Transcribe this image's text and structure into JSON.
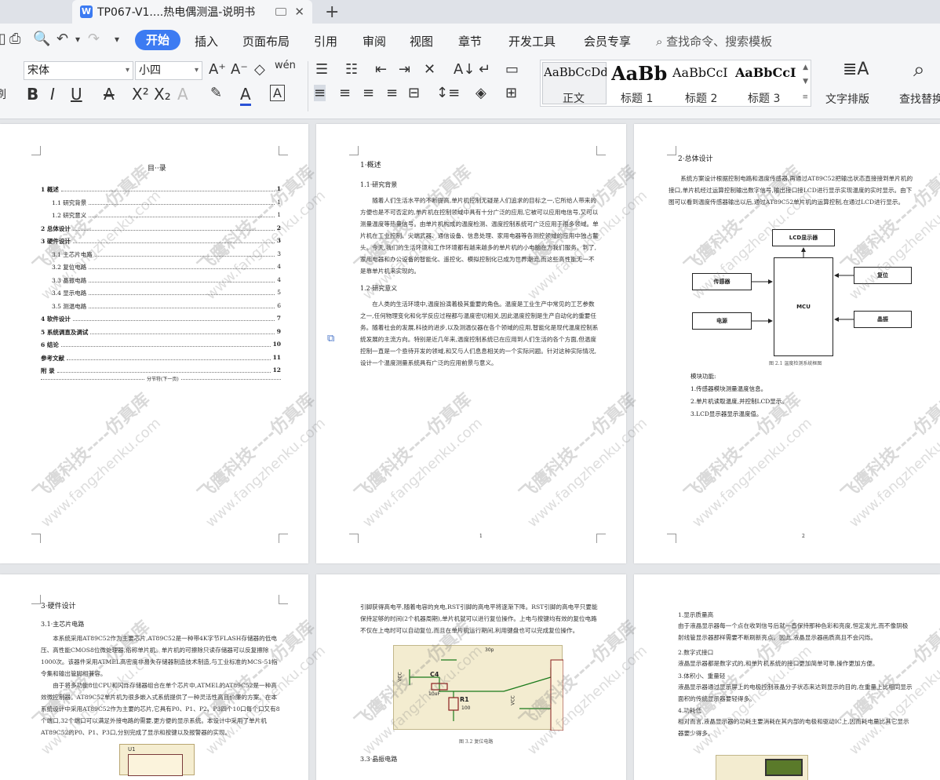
{
  "tab": {
    "title": "TP067-V1....热电偶测温-说明书"
  },
  "menu": {
    "items": [
      "开始",
      "插入",
      "页面布局",
      "引用",
      "审阅",
      "视图",
      "章节",
      "开发工具",
      "会员专享"
    ],
    "search": "查找命令、搜索模板"
  },
  "ribbon": {
    "font": "宋体",
    "size": "小四",
    "styles": [
      {
        "sample": "AaBbCcDd",
        "name": "正文"
      },
      {
        "sample": "AaBb",
        "name": "标题 1"
      },
      {
        "sample": "AaBbCcI",
        "name": "标题 2"
      },
      {
        "sample": "AaBbCcI",
        "name": "标题 3"
      }
    ],
    "text_layout": "文字排版",
    "find_replace": "查找替换"
  },
  "page1": {
    "toc_title": "目··录",
    "toc": [
      {
        "label": "1 概述",
        "page": "1",
        "bold": true,
        "indent": 0
      },
      {
        "label": "1.1 研究背景",
        "page": "1",
        "bold": false,
        "indent": 1
      },
      {
        "label": "1.2 研究意义",
        "page": "1",
        "bold": false,
        "indent": 1
      },
      {
        "label": "2 总体设计",
        "page": "2",
        "bold": true,
        "indent": 0
      },
      {
        "label": "3 硬件设计",
        "page": "3",
        "bold": true,
        "indent": 0
      },
      {
        "label": "3.1 主芯片电路",
        "page": "3",
        "bold": false,
        "indent": 1
      },
      {
        "label": "3.2 复位电路",
        "page": "4",
        "bold": false,
        "indent": 1
      },
      {
        "label": "3.3 晶振电路",
        "page": "4",
        "bold": false,
        "indent": 1
      },
      {
        "label": "3.4 显示电路",
        "page": "5",
        "bold": false,
        "indent": 1
      },
      {
        "label": "3.5 测温电路",
        "page": "6",
        "bold": false,
        "indent": 1
      },
      {
        "label": "4 软件设计",
        "page": "7",
        "bold": true,
        "indent": 0
      },
      {
        "label": "5 系统调直及调试",
        "page": "9",
        "bold": true,
        "indent": 0
      },
      {
        "label": "6 结论",
        "page": "10",
        "bold": true,
        "indent": 0
      },
      {
        "label": "参考文献",
        "page": "11",
        "bold": true,
        "indent": 0
      },
      {
        "label": "附  录",
        "page": "12",
        "bold": true,
        "indent": 0
      }
    ],
    "section_break": "分节符(下一页)"
  },
  "page2": {
    "h1": "1·概述",
    "h11": "1.1·研究背景",
    "p1": "随着人们生活水平的不断提高,单片机控制无疑是人们追求的目标之一,它所给人带来的方便也是不可否定的,单片机在控制领域中具有十分广泛的应用,它被可以应用电信号,又可以测量温度等热量信号。由单片机构成的温度检测、温度控制系统可广泛应用于很多领域。单片机在工业控制、尖端武器、通信设备、信息处理、家用电器等各测控领域的应用中独占鳌头。今天,我们的生活环境和工作环境都有越来越多的单片机的小电脑在为我们服务。到了,家用电器和办公设备的智能化、遥控化、模拟控制化已成为世界潮流,而这些高性能无一不是靠单片机来实现的。",
    "h12": "1.2·研究意义",
    "p2": "在人类的生活环境中,温度扮演着极其重要的角色。温度是工业生产中常见的工艺参数之一,任何物理变化和化学反应过程都与温度密切相关,因此温度控制是生产自动化的重要任务。随着社会的发展,科技的进步,以及测温仪器在各个领域的应用,智能化是现代温度控制系统发展的主流方向。特别是近几年来,温度控制系统已在应用到人们生活的各个方面,但温度控制一直是一个亟待开发的领域,和又与人们息息相关的一个实际问题。针对这种实际情况,设计一个温度测量系统具有广泛的应用前景与意义。",
    "pagenum": "1"
  },
  "page3": {
    "h2": "2·总体设计",
    "p1": "系统方案设计根据控制电路和温度传感器,再通过AT89C52把输出状态直接接到单片机的接口,单片机经过运算控制输出数字信号,输出接口接LCD进行显示实现温度的实时显示。由下图可以看到温度传感器输出以后,通过AT89C52单片机的运算控制,在通过LCD进行显示。",
    "blocks": {
      "lcd": "LCD显示器",
      "sensor": "传感器",
      "reset": "复位",
      "mcu": "MCU",
      "power": "电源",
      "crystal": "晶振"
    },
    "caption": "图 2.1 温度检测系统框图",
    "func_title": "模块功能:",
    "funcs": [
      "1.传感器模块测量温度信息。",
      "2.单片机读取温度,并控制LCD显示。",
      "3.LCD显示器显示温度值。"
    ],
    "pagenum": "2"
  },
  "page4": {
    "h3": "3·硬件设计",
    "h31": "3.1·主芯片电路",
    "p1": "本系统采用AT89C52作为主要芯片,AT89C52是一种带4K字节FLASH存储器的低电压、高性能CMOS8位微处理器,俗称单片机。单片机的可擦除只读存储器可以反复擦除1000次。该器件采用ATMEL高密度非易失存储器制造技术制造,与工业标准的MCS-51指令集和输出管脚相兼容。",
    "p2": "由于将多功能8位CPU和闪烁存储器组合在单个芯片中,ATMEL的AT89C52是一种高效微控制器。AT89C52单片机为很多嵌入式系统提供了一种灵活性高且价廉的方案。在本系统设计中采用AT89C52作为主要的芯片,它具有P0、P1、P2、P3四个10口每个口又有8个端口,32个端口可以满足外接电路的需要,更方便的显示系统。本设计中采用了单片机AT89C52的P0、P1、P3口,分别完成了显示和按键以及报警器的实现。",
    "chip_label": "U1"
  },
  "page5": {
    "p1": "引脚获得高电平,随着电容的充电,RST引脚的高电平将逐渐下降。RST引脚的高电平只要能保持足够的时间(2个机器周期),单片机就可以进行复位操作。上电与按键均有效的复位电路不仅在上电时可以自动复位,而且在单片机运行期间,利用键盘也可以完成复位操作。",
    "labels": {
      "c4": "C4",
      "c4v": "10uF",
      "r1": "R1",
      "r1v": "100",
      "vcc": "VCC",
      "p30": "30p"
    },
    "caption": "图 3.2 复位电路",
    "h33": "3.3·晶振电路"
  },
  "page6": {
    "items": [
      "1.显示质量高",
      "由于液晶显示器每一个点在收到信号后就一直保持那种色彩和亮度,恒定发光,而不像阴极射线管显示器那样需要不断刷新亮点。因此,液晶显示器画质高且不会闪烁。",
      "2.数字式接口",
      "液晶显示器都是数字式的,和单片机系统的接口更加简单可靠,操作更加方便。",
      "3.体积小、重量轻",
      "液晶显示器通过显示屏上的电极控制液晶分子状态来达到显示的目的,在重量上比相同显示面积的传统显示器要轻得多。",
      "4.功耗低",
      "相对而言,液晶显示器的功耗主要消耗在其内部的电极和驱动IC上,因而耗电量比其它显示器要少得多。"
    ]
  },
  "watermark": {
    "brand": "飞鹰科技",
    "site": "www.fangzhenku.com",
    "cn": "仿真库",
    "dash": "飞鹰科技----仿真库"
  }
}
